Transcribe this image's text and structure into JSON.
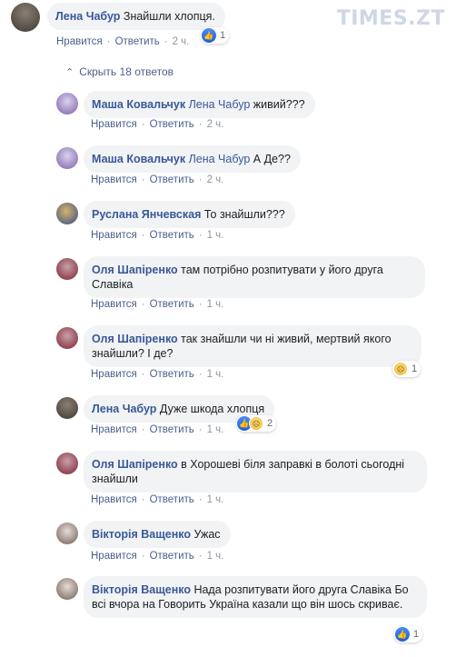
{
  "watermark": "TIMES.ZT",
  "actions": {
    "like": "Нравится",
    "reply": "Ответить"
  },
  "top_comment": {
    "author": "Лена Чабур",
    "text": "Знайшли хлопця.",
    "time": "2 ч.",
    "reactions": "1"
  },
  "toggle_label": "Скрыть 18 ответов",
  "replies": [
    {
      "author": "Маша Ковальчук",
      "mention": "Лена Чабур",
      "text": " живий???",
      "time": "2 ч.",
      "avatar_color": "#7b5ea8"
    },
    {
      "author": "Маша Ковальчук",
      "mention": "Лена Чабур",
      "text": " А Де??",
      "time": "2 ч.",
      "avatar_color": "#7b5ea8"
    },
    {
      "author": "Руслана Янчевская",
      "mention": "",
      "text": " То знайшли???",
      "time": "1 ч.",
      "avatar_color": "#2e4a8a"
    },
    {
      "author": "Оля Шапіренко",
      "mention": "",
      "text": " там потрібно розпитувати у його друга Славіка",
      "time": "1 ч.",
      "avatar_color": "#7a2231"
    },
    {
      "author": "Оля Шапіренко",
      "mention": "",
      "text": " так знайшли чи ні живий, мертвий якого знайшли? І де?",
      "time": "1 ч.",
      "avatar_color": "#7a2231",
      "reactions": "1"
    },
    {
      "author": "Лена Чабур",
      "mention": "",
      "text": " Дуже шкода хлопця",
      "time": "1 ч.",
      "avatar_color": "#4a3b38",
      "reactions": "2"
    },
    {
      "author": "Оля Шапіренко",
      "mention": "",
      "text": " в Хорошеві біля заправкі в болоті сьогодні знайшли",
      "time": "1 ч.",
      "avatar_color": "#7a2231"
    },
    {
      "author": "Вікторія Ващенко",
      "mention": "",
      "text": " Ужас",
      "time": "1 ч.",
      "avatar_color": "#6b5b55"
    },
    {
      "author": "Вікторія Ващенко",
      "mention": "",
      "text": " Нада розпитувати його друга Славіка Бо всі вчора на Говорить Україна казали що він шось скриває.",
      "time": "1 ч.",
      "avatar_color": "#6b5b55",
      "reactions": "1"
    }
  ]
}
